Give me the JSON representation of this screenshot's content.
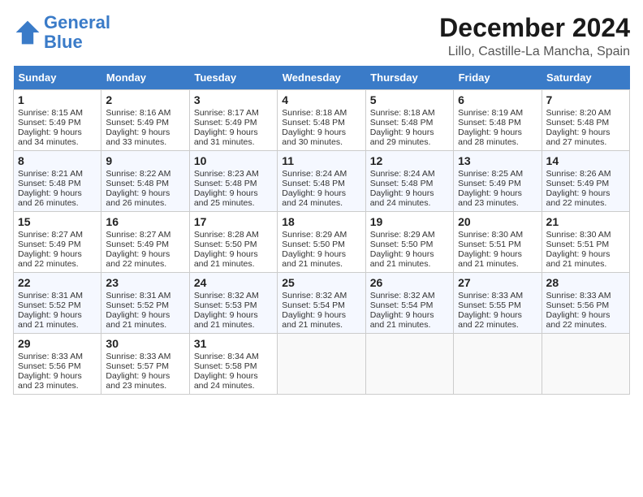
{
  "header": {
    "logo_line1": "General",
    "logo_line2": "Blue",
    "month_title": "December 2024",
    "location": "Lillo, Castille-La Mancha, Spain"
  },
  "calendar": {
    "days_of_week": [
      "Sunday",
      "Monday",
      "Tuesday",
      "Wednesday",
      "Thursday",
      "Friday",
      "Saturday"
    ],
    "weeks": [
      [
        null,
        null,
        null,
        null,
        null,
        null,
        null
      ]
    ],
    "cells": [
      {
        "day": "1",
        "col": 0,
        "week": 0,
        "sunrise": "8:15 AM",
        "sunset": "5:49 PM",
        "daylight": "9 hours and 34 minutes."
      },
      {
        "day": "2",
        "col": 1,
        "week": 0,
        "sunrise": "8:16 AM",
        "sunset": "5:49 PM",
        "daylight": "9 hours and 33 minutes."
      },
      {
        "day": "3",
        "col": 2,
        "week": 0,
        "sunrise": "8:17 AM",
        "sunset": "5:49 PM",
        "daylight": "9 hours and 31 minutes."
      },
      {
        "day": "4",
        "col": 3,
        "week": 0,
        "sunrise": "8:18 AM",
        "sunset": "5:48 PM",
        "daylight": "9 hours and 30 minutes."
      },
      {
        "day": "5",
        "col": 4,
        "week": 0,
        "sunrise": "8:18 AM",
        "sunset": "5:48 PM",
        "daylight": "9 hours and 29 minutes."
      },
      {
        "day": "6",
        "col": 5,
        "week": 0,
        "sunrise": "8:19 AM",
        "sunset": "5:48 PM",
        "daylight": "9 hours and 28 minutes."
      },
      {
        "day": "7",
        "col": 6,
        "week": 0,
        "sunrise": "8:20 AM",
        "sunset": "5:48 PM",
        "daylight": "9 hours and 27 minutes."
      },
      {
        "day": "8",
        "col": 0,
        "week": 1,
        "sunrise": "8:21 AM",
        "sunset": "5:48 PM",
        "daylight": "9 hours and 26 minutes."
      },
      {
        "day": "9",
        "col": 1,
        "week": 1,
        "sunrise": "8:22 AM",
        "sunset": "5:48 PM",
        "daylight": "9 hours and 26 minutes."
      },
      {
        "day": "10",
        "col": 2,
        "week": 1,
        "sunrise": "8:23 AM",
        "sunset": "5:48 PM",
        "daylight": "9 hours and 25 minutes."
      },
      {
        "day": "11",
        "col": 3,
        "week": 1,
        "sunrise": "8:24 AM",
        "sunset": "5:48 PM",
        "daylight": "9 hours and 24 minutes."
      },
      {
        "day": "12",
        "col": 4,
        "week": 1,
        "sunrise": "8:24 AM",
        "sunset": "5:48 PM",
        "daylight": "9 hours and 24 minutes."
      },
      {
        "day": "13",
        "col": 5,
        "week": 1,
        "sunrise": "8:25 AM",
        "sunset": "5:49 PM",
        "daylight": "9 hours and 23 minutes."
      },
      {
        "day": "14",
        "col": 6,
        "week": 1,
        "sunrise": "8:26 AM",
        "sunset": "5:49 PM",
        "daylight": "9 hours and 22 minutes."
      },
      {
        "day": "15",
        "col": 0,
        "week": 2,
        "sunrise": "8:27 AM",
        "sunset": "5:49 PM",
        "daylight": "9 hours and 22 minutes."
      },
      {
        "day": "16",
        "col": 1,
        "week": 2,
        "sunrise": "8:27 AM",
        "sunset": "5:49 PM",
        "daylight": "9 hours and 22 minutes."
      },
      {
        "day": "17",
        "col": 2,
        "week": 2,
        "sunrise": "8:28 AM",
        "sunset": "5:50 PM",
        "daylight": "9 hours and 21 minutes."
      },
      {
        "day": "18",
        "col": 3,
        "week": 2,
        "sunrise": "8:29 AM",
        "sunset": "5:50 PM",
        "daylight": "9 hours and 21 minutes."
      },
      {
        "day": "19",
        "col": 4,
        "week": 2,
        "sunrise": "8:29 AM",
        "sunset": "5:50 PM",
        "daylight": "9 hours and 21 minutes."
      },
      {
        "day": "20",
        "col": 5,
        "week": 2,
        "sunrise": "8:30 AM",
        "sunset": "5:51 PM",
        "daylight": "9 hours and 21 minutes."
      },
      {
        "day": "21",
        "col": 6,
        "week": 2,
        "sunrise": "8:30 AM",
        "sunset": "5:51 PM",
        "daylight": "9 hours and 21 minutes."
      },
      {
        "day": "22",
        "col": 0,
        "week": 3,
        "sunrise": "8:31 AM",
        "sunset": "5:52 PM",
        "daylight": "9 hours and 21 minutes."
      },
      {
        "day": "23",
        "col": 1,
        "week": 3,
        "sunrise": "8:31 AM",
        "sunset": "5:52 PM",
        "daylight": "9 hours and 21 minutes."
      },
      {
        "day": "24",
        "col": 2,
        "week": 3,
        "sunrise": "8:32 AM",
        "sunset": "5:53 PM",
        "daylight": "9 hours and 21 minutes."
      },
      {
        "day": "25",
        "col": 3,
        "week": 3,
        "sunrise": "8:32 AM",
        "sunset": "5:54 PM",
        "daylight": "9 hours and 21 minutes."
      },
      {
        "day": "26",
        "col": 4,
        "week": 3,
        "sunrise": "8:32 AM",
        "sunset": "5:54 PM",
        "daylight": "9 hours and 21 minutes."
      },
      {
        "day": "27",
        "col": 5,
        "week": 3,
        "sunrise": "8:33 AM",
        "sunset": "5:55 PM",
        "daylight": "9 hours and 22 minutes."
      },
      {
        "day": "28",
        "col": 6,
        "week": 3,
        "sunrise": "8:33 AM",
        "sunset": "5:56 PM",
        "daylight": "9 hours and 22 minutes."
      },
      {
        "day": "29",
        "col": 0,
        "week": 4,
        "sunrise": "8:33 AM",
        "sunset": "5:56 PM",
        "daylight": "9 hours and 23 minutes."
      },
      {
        "day": "30",
        "col": 1,
        "week": 4,
        "sunrise": "8:33 AM",
        "sunset": "5:57 PM",
        "daylight": "9 hours and 23 minutes."
      },
      {
        "day": "31",
        "col": 2,
        "week": 4,
        "sunrise": "8:34 AM",
        "sunset": "5:58 PM",
        "daylight": "9 hours and 24 minutes."
      }
    ]
  }
}
